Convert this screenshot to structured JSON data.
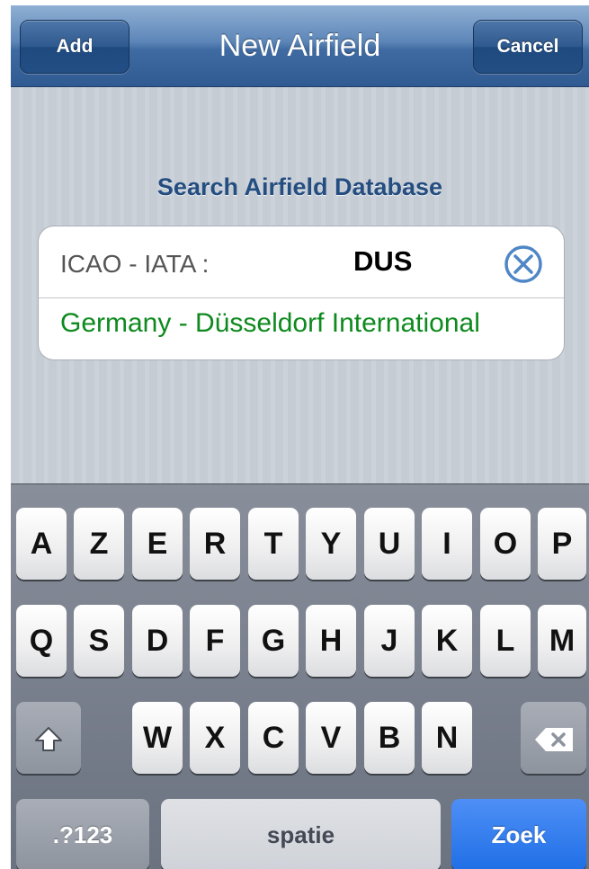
{
  "navbar": {
    "title": "New Airfield",
    "add_label": "Add",
    "cancel_label": "Cancel"
  },
  "search": {
    "header": "Search Airfield Database",
    "field_label": "ICAO - IATA :",
    "field_value": "DUS",
    "result": "Germany - Düsseldorf International",
    "result_color": "#0e8a1e"
  },
  "keyboard": {
    "row1": [
      "A",
      "Z",
      "E",
      "R",
      "T",
      "Y",
      "U",
      "I",
      "O",
      "P"
    ],
    "row2": [
      "Q",
      "S",
      "D",
      "F",
      "G",
      "H",
      "J",
      "K",
      "L",
      "M"
    ],
    "row3": [
      "W",
      "X",
      "C",
      "V",
      "B",
      "N"
    ],
    "shift_icon": "shift-icon",
    "backspace_icon": "backspace-icon",
    "numbers_label": ".?123",
    "space_label": "spatie",
    "return_label": "Zoek",
    "return_color": "#1f6fe6"
  },
  "colors": {
    "navbar": "#3f6aa2",
    "header_text": "#244d80"
  }
}
